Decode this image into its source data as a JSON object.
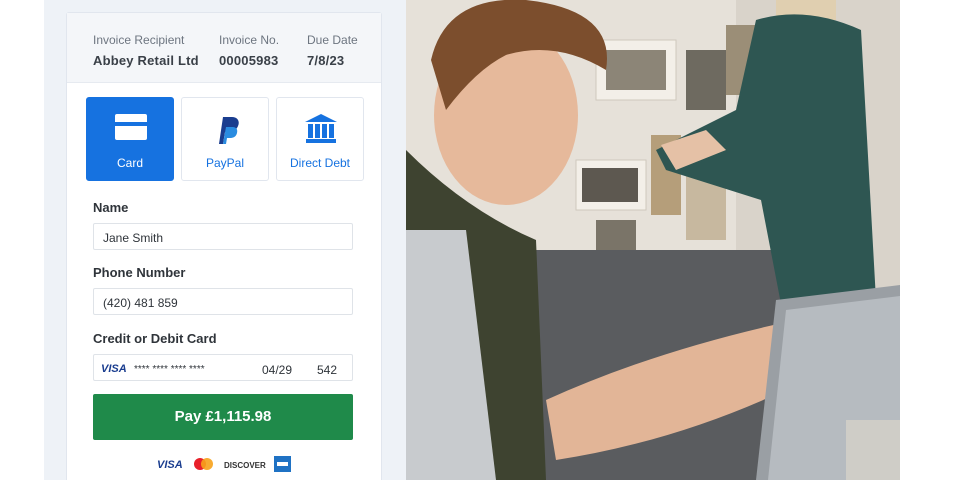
{
  "invoice": {
    "recipient_label": "Invoice Recipient",
    "recipient_value": "Abbey Retail Ltd",
    "number_label": "Invoice No.",
    "number_value": "00005983",
    "due_label": "Due Date",
    "due_value": "7/8/23"
  },
  "payment_methods": [
    {
      "label": "Card",
      "icon": "card-icon",
      "selected": true
    },
    {
      "label": "PayPal",
      "icon": "paypal-icon",
      "selected": false
    },
    {
      "label": "Direct Debt",
      "icon": "bank-icon",
      "selected": false
    }
  ],
  "form": {
    "name_label": "Name",
    "name_value": "Jane Smith",
    "phone_label": "Phone Number",
    "phone_value": "(420) 481 859",
    "card_label": "Credit or Debit Card",
    "card_brand": "VISA",
    "card_number": "**** **** **** ****",
    "card_expiry": "04/29",
    "card_cvc": "542"
  },
  "pay_button_label": "Pay £1,115.98",
  "accepted_cards": [
    "VISA",
    "mastercard-icon",
    "DISCOVER",
    "amex-icon"
  ],
  "colors": {
    "primary": "#1672e0",
    "pay": "#1f8a4a",
    "panel_bg": "#eef2f7"
  },
  "photo": {
    "description_icon": "photo-man-on-laptop-in-gallery"
  }
}
